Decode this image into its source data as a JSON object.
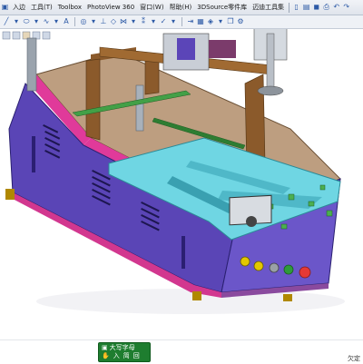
{
  "menubar": {
    "items": [
      "入边",
      "工具(T)",
      "Toolbox",
      "PhotoView 360",
      "窗口(W)",
      "帮助(H)",
      "3DSource零件库",
      "迈迪工具集"
    ]
  },
  "toolbar": {
    "icons": [
      "new-doc-icon",
      "open-icon",
      "save-icon",
      "print-icon",
      "undo-icon",
      "redo-icon"
    ]
  },
  "status": {
    "ime_label": "大写字母",
    "ime_symbols": [
      "入",
      "简",
      "回"
    ],
    "right_text": "欠定"
  },
  "colors": {
    "cabinet_front": "#5b45b8",
    "cabinet_top": "#b89b7c",
    "fixture": "#5fd0de",
    "frame_wood": "#8b5a2b",
    "pink_trim": "#e03a9a",
    "panel_side": "#6b55c8"
  }
}
